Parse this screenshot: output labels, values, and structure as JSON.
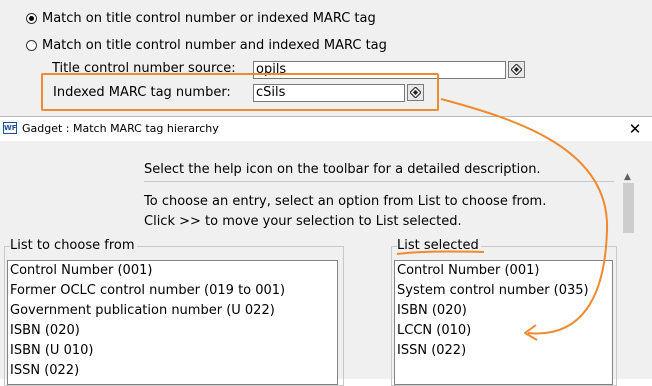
{
  "options": {
    "radio_or": "Match on title control number or indexed MARC tag",
    "radio_and": "Match on title control number and indexed MARC tag",
    "selected": "radio_or"
  },
  "fields": {
    "source_label": "Title control number source:",
    "source_value": "opils",
    "tag_label": "Indexed MARC tag number:",
    "tag_value": "cSils"
  },
  "dialog": {
    "app_icon": "WF",
    "title": "Gadget : Match MARC tag hierarchy",
    "close_label": "✕",
    "help_text": "Select the help icon on the toolbar for a detailed description.",
    "instruction_1": "To choose an entry, select an option from List to choose from.",
    "instruction_2": "Click >> to move your selection to List selected.",
    "list_from_label": "List to choose from",
    "list_selected_label": "List selected",
    "list_from": [
      "Control Number (001)",
      "Former OCLC control number (019 to 001)",
      "Government publication number (U 022)",
      "ISBN (020)",
      "ISBN (U 010)",
      "ISSN (022)"
    ],
    "list_selected": [
      "Control Number (001)",
      "System control number (035)",
      "ISBN (020)",
      "LCCN (010)",
      "ISSN (022)"
    ]
  },
  "icons": {
    "help_button": "lookup-icon",
    "close": "close-icon",
    "scroll_up": "chevron-up-icon"
  },
  "colors": {
    "annotation": "#f08a30",
    "window_bg": "#f0f0f0"
  }
}
